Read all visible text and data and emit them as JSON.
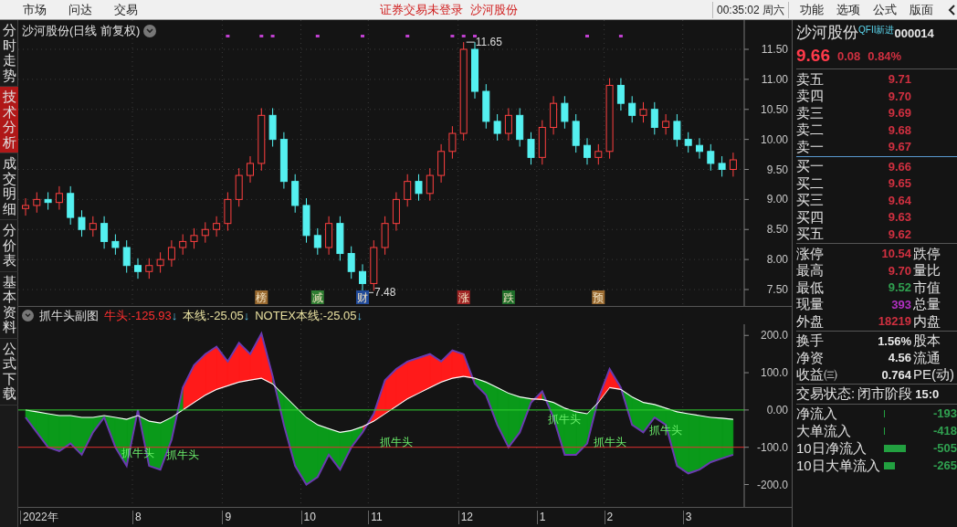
{
  "top_bar": {
    "menus": [
      {
        "label": "市场"
      },
      {
        "label": "问达"
      },
      {
        "label": "交易"
      }
    ],
    "notice": "证券交易未登录",
    "stock": "沙河股份",
    "time": "00:35:02 周六",
    "right_menus": [
      {
        "label": "功能"
      },
      {
        "label": "选项"
      },
      {
        "label": "公式"
      },
      {
        "label": "版面"
      }
    ]
  },
  "side_tabs": [
    {
      "label": "分时走势",
      "selected": false
    },
    {
      "label": "技术分析",
      "selected": true
    },
    {
      "label": "成交明细",
      "selected": false
    },
    {
      "label": "分价表",
      "selected": false
    },
    {
      "label": "基本资料",
      "selected": false
    },
    {
      "label": "公式下载",
      "selected": false
    }
  ],
  "main_chart": {
    "title": "沙河股份(日线 前复权)",
    "price_labels": [
      "11.50",
      "11.00",
      "10.50",
      "10.00",
      "9.50",
      "9.00",
      "8.50",
      "8.00",
      "7.50"
    ],
    "callouts": [
      "11.65",
      "7.48"
    ],
    "events": [
      {
        "kind": "badge",
        "label": "榜",
        "color": "#9a6a30"
      },
      {
        "kind": "badge",
        "label": "减",
        "color": "#2e7d32"
      },
      {
        "kind": "badge",
        "label": "财",
        "color": "#204a9a"
      },
      {
        "kind": "badge",
        "label": "涨",
        "color": "#a02424"
      },
      {
        "kind": "badge",
        "label": "跌",
        "color": "#1f6e2a"
      },
      {
        "kind": "badge",
        "label": "预",
        "color": "#9a6a30"
      }
    ]
  },
  "indicator": {
    "name": "抓牛头副图",
    "legend": [
      {
        "name": "牛头:",
        "value": "-125.93",
        "arrow": "↓",
        "color": "#ff3030"
      },
      {
        "name": "本线:",
        "value": "-25.05",
        "arrow": "↓",
        "color": "#e8e0a0"
      },
      {
        "name": "NOTEX本线:",
        "value": "-25.05",
        "arrow": "↓",
        "color": "#e8e0a0"
      }
    ],
    "axis_labels": [
      "200.0",
      "100.0",
      "0.00",
      "-100.0",
      "-200.0"
    ],
    "signals": [
      "抓牛头",
      "抓牛头",
      "抓牛头",
      "抓牛头",
      "抓牛头",
      "抓牛头"
    ]
  },
  "x_axis": {
    "labels": [
      "2022年",
      "8",
      "9",
      "10",
      "11",
      "12",
      "1",
      "2",
      "3"
    ]
  },
  "quote": {
    "name": "沙河股份",
    "tag": "QFII新进",
    "code": "000014",
    "price": "9.66",
    "change": "0.08",
    "percent": "0.84%",
    "asks": [
      {
        "label": "卖五",
        "price": "9.71"
      },
      {
        "label": "卖四",
        "price": "9.70"
      },
      {
        "label": "卖三",
        "price": "9.69"
      },
      {
        "label": "卖二",
        "price": "9.68"
      },
      {
        "label": "卖一",
        "price": "9.67"
      }
    ],
    "bids": [
      {
        "label": "买一",
        "price": "9.66"
      },
      {
        "label": "买二",
        "price": "9.65"
      },
      {
        "label": "买三",
        "price": "9.64"
      },
      {
        "label": "买四",
        "price": "9.63"
      },
      {
        "label": "买五",
        "price": "9.62"
      }
    ],
    "stats": [
      {
        "label": "涨停",
        "value": "10.54",
        "label_2": "跌停",
        "color": "#d03040"
      },
      {
        "label": "最高",
        "value": "9.70",
        "label_2": "量比",
        "color": "#d03040"
      },
      {
        "label": "最低",
        "value": "9.52",
        "label_2": "市值",
        "color": "#30a050"
      },
      {
        "label": "现量",
        "value": "393",
        "label_2": "总量",
        "color": "#b030c0"
      },
      {
        "label": "外盘",
        "value": "18219",
        "label_2": "内盘",
        "color": "#d03040"
      }
    ],
    "stats_2": [
      {
        "label": "换手",
        "value": "1.56%",
        "label_2": "股本"
      },
      {
        "label": "净资",
        "value": "4.56",
        "label_2": "流通"
      },
      {
        "label": "收益㈢",
        "value": "0.764",
        "label_2": "PE(动)"
      }
    ],
    "status": {
      "label": "交易状态:",
      "value": "闭市阶段",
      "time": "15:0"
    },
    "flows": [
      {
        "label": "净流入",
        "value": "-193"
      },
      {
        "label": "大单流入",
        "value": "-418"
      },
      {
        "label": "10日净流入",
        "value": "-505"
      },
      {
        "label": "10日大单流入",
        "value": "-265"
      }
    ]
  }
}
